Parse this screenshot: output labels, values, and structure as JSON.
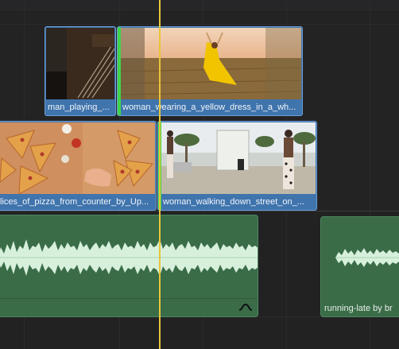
{
  "timeline": {
    "video_track_2": [
      {
        "name": "man_playing_piano_clip",
        "label": "man_playing_...",
        "thumb": "piano"
      },
      {
        "name": "woman_yellow_dress_clip",
        "label": "woman_wearing_a_yellow_dress_in_a_wh...",
        "thumb": "field",
        "selected_edge": true
      }
    ],
    "video_track_1": [
      {
        "name": "pizza_clip",
        "label": "lices_of_pizza_from_counter_by_Up...",
        "thumb": "pizza"
      },
      {
        "name": "woman_walking_clip",
        "label": "woman_walking_down_street_on_...",
        "thumb": "street",
        "selected_edge": true
      }
    ],
    "audio_track": [
      {
        "name": "audio_clip_main",
        "label": "",
        "has_curve_icon": true
      },
      {
        "name": "running_late_clip",
        "label": "running-late by br"
      }
    ]
  },
  "colors": {
    "video_clip": "#3f74ad",
    "audio_clip": "#3a6c48",
    "playhead": "#e9c53a",
    "selection_edge": "#40d44b"
  }
}
